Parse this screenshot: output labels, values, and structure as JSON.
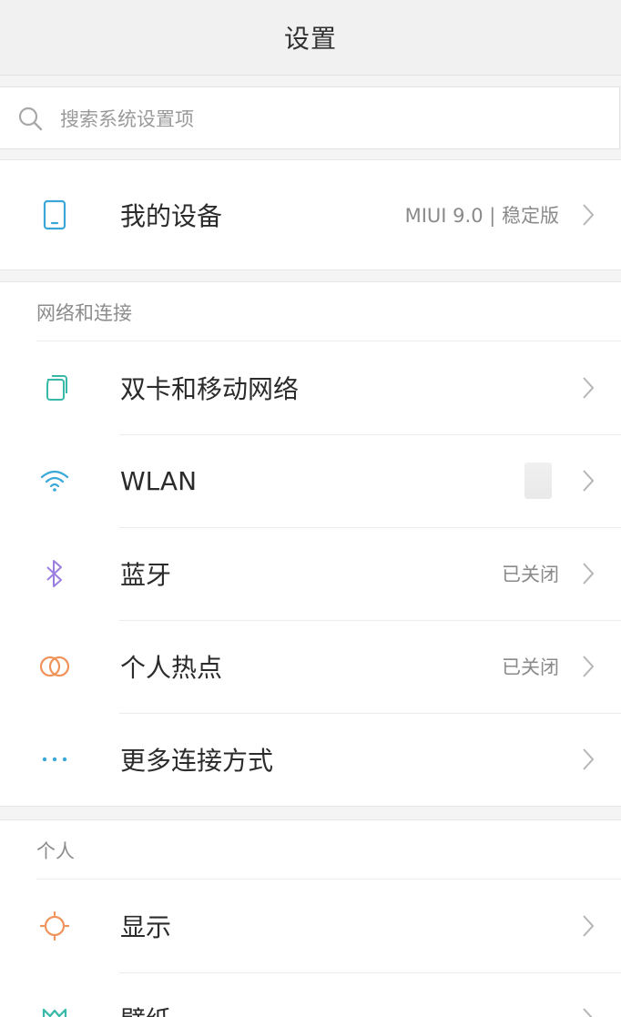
{
  "header": {
    "title": "设置"
  },
  "search": {
    "placeholder": "搜索系统设置项"
  },
  "device": {
    "label": "我的设备",
    "value": "MIUI 9.0 | 稳定版",
    "icon": "device-icon",
    "icon_color": "#3aa7d8"
  },
  "network": {
    "section_title": "网络和连接",
    "items": [
      {
        "label": "双卡和移动网络",
        "value": "",
        "icon": "dual-sim-icon",
        "icon_color": "#38b8a8"
      },
      {
        "label": "WLAN",
        "value": "",
        "icon": "wifi-icon",
        "icon_color": "#38a8d8"
      },
      {
        "label": "蓝牙",
        "value": "已关闭",
        "icon": "bluetooth-icon",
        "icon_color": "#9b7fe0"
      },
      {
        "label": "个人热点",
        "value": "已关闭",
        "icon": "hotspot-icon",
        "icon_color": "#f0935a"
      },
      {
        "label": "更多连接方式",
        "value": "",
        "icon": "more-dots-icon",
        "icon_color": "#38a8d8"
      }
    ]
  },
  "personal": {
    "section_title": "个人",
    "items": [
      {
        "label": "显示",
        "value": "",
        "icon": "sun-icon",
        "icon_color": "#f0935a"
      },
      {
        "label": "壁纸",
        "value": "",
        "icon": "wallpaper-icon",
        "icon_color": "#38b8a8"
      }
    ]
  }
}
